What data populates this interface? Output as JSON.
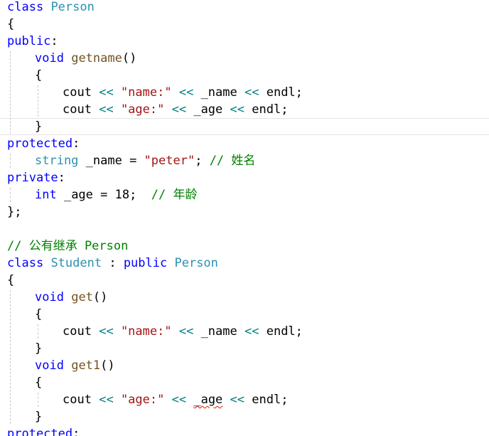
{
  "editor": {
    "lines": [
      {
        "indent": 0,
        "tokens": [
          {
            "t": "class",
            "k": "keyword"
          },
          {
            "t": " ",
            "k": "plain"
          },
          {
            "t": "Person",
            "k": "type"
          }
        ]
      },
      {
        "indent": 0,
        "tokens": [
          {
            "t": "{",
            "k": "plain"
          }
        ]
      },
      {
        "indent": 0,
        "tokens": [
          {
            "t": "public",
            "k": "keyword"
          },
          {
            "t": ":",
            "k": "plain"
          }
        ]
      },
      {
        "indent": 1,
        "tokens": [
          {
            "t": "void",
            "k": "keyword"
          },
          {
            "t": " ",
            "k": "plain"
          },
          {
            "t": "getname",
            "k": "func"
          },
          {
            "t": "()",
            "k": "plain"
          }
        ]
      },
      {
        "indent": 1,
        "tokens": [
          {
            "t": "{",
            "k": "plain"
          }
        ]
      },
      {
        "indent": 2,
        "tokens": [
          {
            "t": "cout",
            "k": "plain"
          },
          {
            "t": " ",
            "k": "plain"
          },
          {
            "t": "<<",
            "k": "op"
          },
          {
            "t": " ",
            "k": "plain"
          },
          {
            "t": "\"name:\"",
            "k": "string"
          },
          {
            "t": " ",
            "k": "plain"
          },
          {
            "t": "<<",
            "k": "op"
          },
          {
            "t": " _name ",
            "k": "plain"
          },
          {
            "t": "<<",
            "k": "op"
          },
          {
            "t": " ",
            "k": "plain"
          },
          {
            "t": "endl",
            "k": "plain"
          },
          {
            "t": ";",
            "k": "plain"
          }
        ]
      },
      {
        "indent": 2,
        "tokens": [
          {
            "t": "cout",
            "k": "plain"
          },
          {
            "t": " ",
            "k": "plain"
          },
          {
            "t": "<<",
            "k": "op"
          },
          {
            "t": " ",
            "k": "plain"
          },
          {
            "t": "\"age:\"",
            "k": "string"
          },
          {
            "t": " ",
            "k": "plain"
          },
          {
            "t": "<<",
            "k": "op"
          },
          {
            "t": " _age ",
            "k": "plain"
          },
          {
            "t": "<<",
            "k": "op"
          },
          {
            "t": " ",
            "k": "plain"
          },
          {
            "t": "endl",
            "k": "plain"
          },
          {
            "t": ";",
            "k": "plain"
          }
        ]
      },
      {
        "indent": 1,
        "current": true,
        "tokens": [
          {
            "t": "}",
            "k": "plain"
          }
        ]
      },
      {
        "indent": 0,
        "tokens": [
          {
            "t": "protected",
            "k": "keyword"
          },
          {
            "t": ":",
            "k": "plain"
          }
        ]
      },
      {
        "indent": 1,
        "tokens": [
          {
            "t": "string",
            "k": "type"
          },
          {
            "t": " _name = ",
            "k": "plain"
          },
          {
            "t": "\"peter\"",
            "k": "string"
          },
          {
            "t": "; ",
            "k": "plain"
          },
          {
            "t": "// 姓名",
            "k": "comment"
          }
        ]
      },
      {
        "indent": 0,
        "tokens": [
          {
            "t": "private",
            "k": "keyword"
          },
          {
            "t": ":",
            "k": "plain"
          }
        ]
      },
      {
        "indent": 1,
        "tokens": [
          {
            "t": "int",
            "k": "keyword"
          },
          {
            "t": " _age = 18;  ",
            "k": "plain"
          },
          {
            "t": "// 年龄",
            "k": "comment"
          }
        ]
      },
      {
        "indent": 0,
        "tokens": [
          {
            "t": "};",
            "k": "plain"
          }
        ]
      },
      {
        "indent": 0,
        "tokens": []
      },
      {
        "indent": 0,
        "tokens": [
          {
            "t": "// 公有继承 Person",
            "k": "comment"
          }
        ]
      },
      {
        "indent": 0,
        "tokens": [
          {
            "t": "class",
            "k": "keyword"
          },
          {
            "t": " ",
            "k": "plain"
          },
          {
            "t": "Student",
            "k": "type"
          },
          {
            "t": " : ",
            "k": "plain"
          },
          {
            "t": "public",
            "k": "keyword"
          },
          {
            "t": " ",
            "k": "plain"
          },
          {
            "t": "Person",
            "k": "type"
          }
        ]
      },
      {
        "indent": 0,
        "tokens": [
          {
            "t": "{",
            "k": "plain"
          }
        ]
      },
      {
        "indent": 1,
        "tokens": [
          {
            "t": "void",
            "k": "keyword"
          },
          {
            "t": " ",
            "k": "plain"
          },
          {
            "t": "get",
            "k": "func"
          },
          {
            "t": "()",
            "k": "plain"
          }
        ]
      },
      {
        "indent": 1,
        "tokens": [
          {
            "t": "{",
            "k": "plain"
          }
        ]
      },
      {
        "indent": 2,
        "tokens": [
          {
            "t": "cout",
            "k": "plain"
          },
          {
            "t": " ",
            "k": "plain"
          },
          {
            "t": "<<",
            "k": "op"
          },
          {
            "t": " ",
            "k": "plain"
          },
          {
            "t": "\"name:\"",
            "k": "string"
          },
          {
            "t": " ",
            "k": "plain"
          },
          {
            "t": "<<",
            "k": "op"
          },
          {
            "t": " _name ",
            "k": "plain"
          },
          {
            "t": "<<",
            "k": "op"
          },
          {
            "t": " ",
            "k": "plain"
          },
          {
            "t": "endl",
            "k": "plain"
          },
          {
            "t": ";",
            "k": "plain"
          }
        ]
      },
      {
        "indent": 1,
        "tokens": [
          {
            "t": "}",
            "k": "plain"
          }
        ]
      },
      {
        "indent": 1,
        "tokens": [
          {
            "t": "void",
            "k": "keyword"
          },
          {
            "t": " ",
            "k": "plain"
          },
          {
            "t": "get1",
            "k": "func"
          },
          {
            "t": "()",
            "k": "plain"
          }
        ]
      },
      {
        "indent": 1,
        "tokens": [
          {
            "t": "{",
            "k": "plain"
          }
        ]
      },
      {
        "indent": 2,
        "tokens": [
          {
            "t": "cout",
            "k": "plain"
          },
          {
            "t": " ",
            "k": "plain"
          },
          {
            "t": "<<",
            "k": "op"
          },
          {
            "t": " ",
            "k": "plain"
          },
          {
            "t": "\"age:\"",
            "k": "string"
          },
          {
            "t": " ",
            "k": "plain"
          },
          {
            "t": "<<",
            "k": "op"
          },
          {
            "t": " ",
            "k": "plain"
          },
          {
            "t": "_age",
            "k": "plain",
            "error": true
          },
          {
            "t": " ",
            "k": "plain"
          },
          {
            "t": "<<",
            "k": "op"
          },
          {
            "t": " ",
            "k": "plain"
          },
          {
            "t": "endl",
            "k": "plain"
          },
          {
            "t": ";",
            "k": "plain"
          }
        ]
      },
      {
        "indent": 1,
        "tokens": [
          {
            "t": "}",
            "k": "plain"
          }
        ]
      },
      {
        "indent": 0,
        "tokens": [
          {
            "t": "protected",
            "k": "keyword"
          },
          {
            "t": ":",
            "k": "plain"
          }
        ]
      }
    ]
  }
}
